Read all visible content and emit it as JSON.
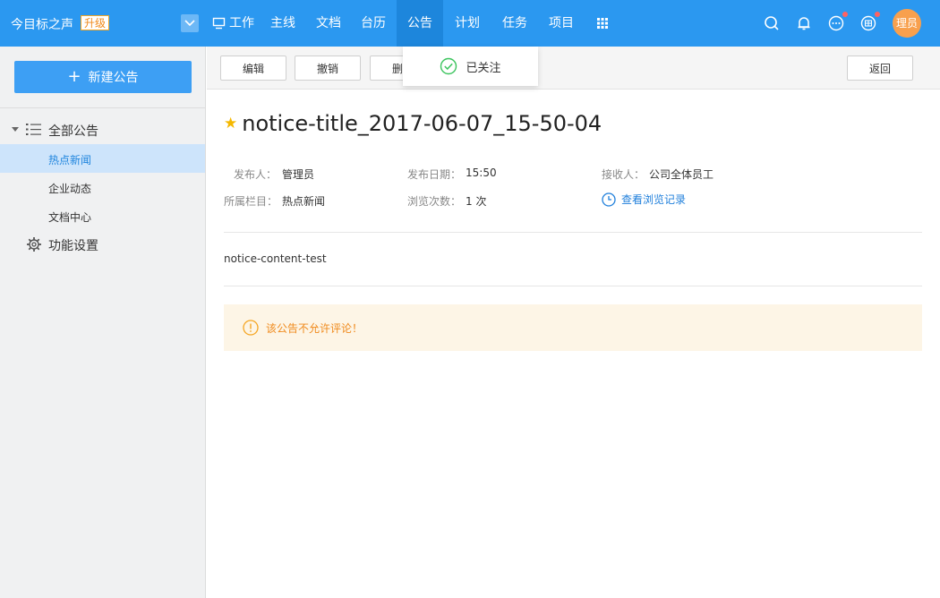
{
  "header": {
    "brand": "今目标之声",
    "upgrade": "升级",
    "nav": [
      {
        "label": "工作",
        "icon": "monitor-icon"
      },
      {
        "label": "主线"
      },
      {
        "label": "文档"
      },
      {
        "label": "台历"
      },
      {
        "label": "公告",
        "active": true
      },
      {
        "label": "计划"
      },
      {
        "label": "任务"
      },
      {
        "label": "项目"
      }
    ],
    "avatar": "理员"
  },
  "sidebar": {
    "new_button": "新建公告",
    "root": "全部公告",
    "items": [
      {
        "label": "热点新闻",
        "active": true
      },
      {
        "label": "企业动态"
      },
      {
        "label": "文档中心"
      }
    ],
    "settings": "功能设置"
  },
  "toolbar": {
    "edit": "编辑",
    "revoke": "撤销",
    "delete": "删",
    "back": "返回"
  },
  "popover": {
    "text": "已关注"
  },
  "notice": {
    "title": "notice-title_2017-06-07_15-50-04",
    "publisher_label": "发布人：",
    "publisher": "管理员",
    "date_label": "发布日期：",
    "date": "15:50",
    "receiver_label": "接收人：",
    "receiver": "公司全体员工",
    "column_label": "所属栏目：",
    "column": "热点新闻",
    "views_label": "浏览次数：",
    "views": "1 次",
    "view_records": "查看浏览记录",
    "content": "notice-content-test",
    "no_comment": "该公告不允许评论！"
  },
  "colors": {
    "header": "#2b98f0",
    "accent": "#3d9ff4",
    "warning": "#f08a1c",
    "star": "#f5b800"
  }
}
